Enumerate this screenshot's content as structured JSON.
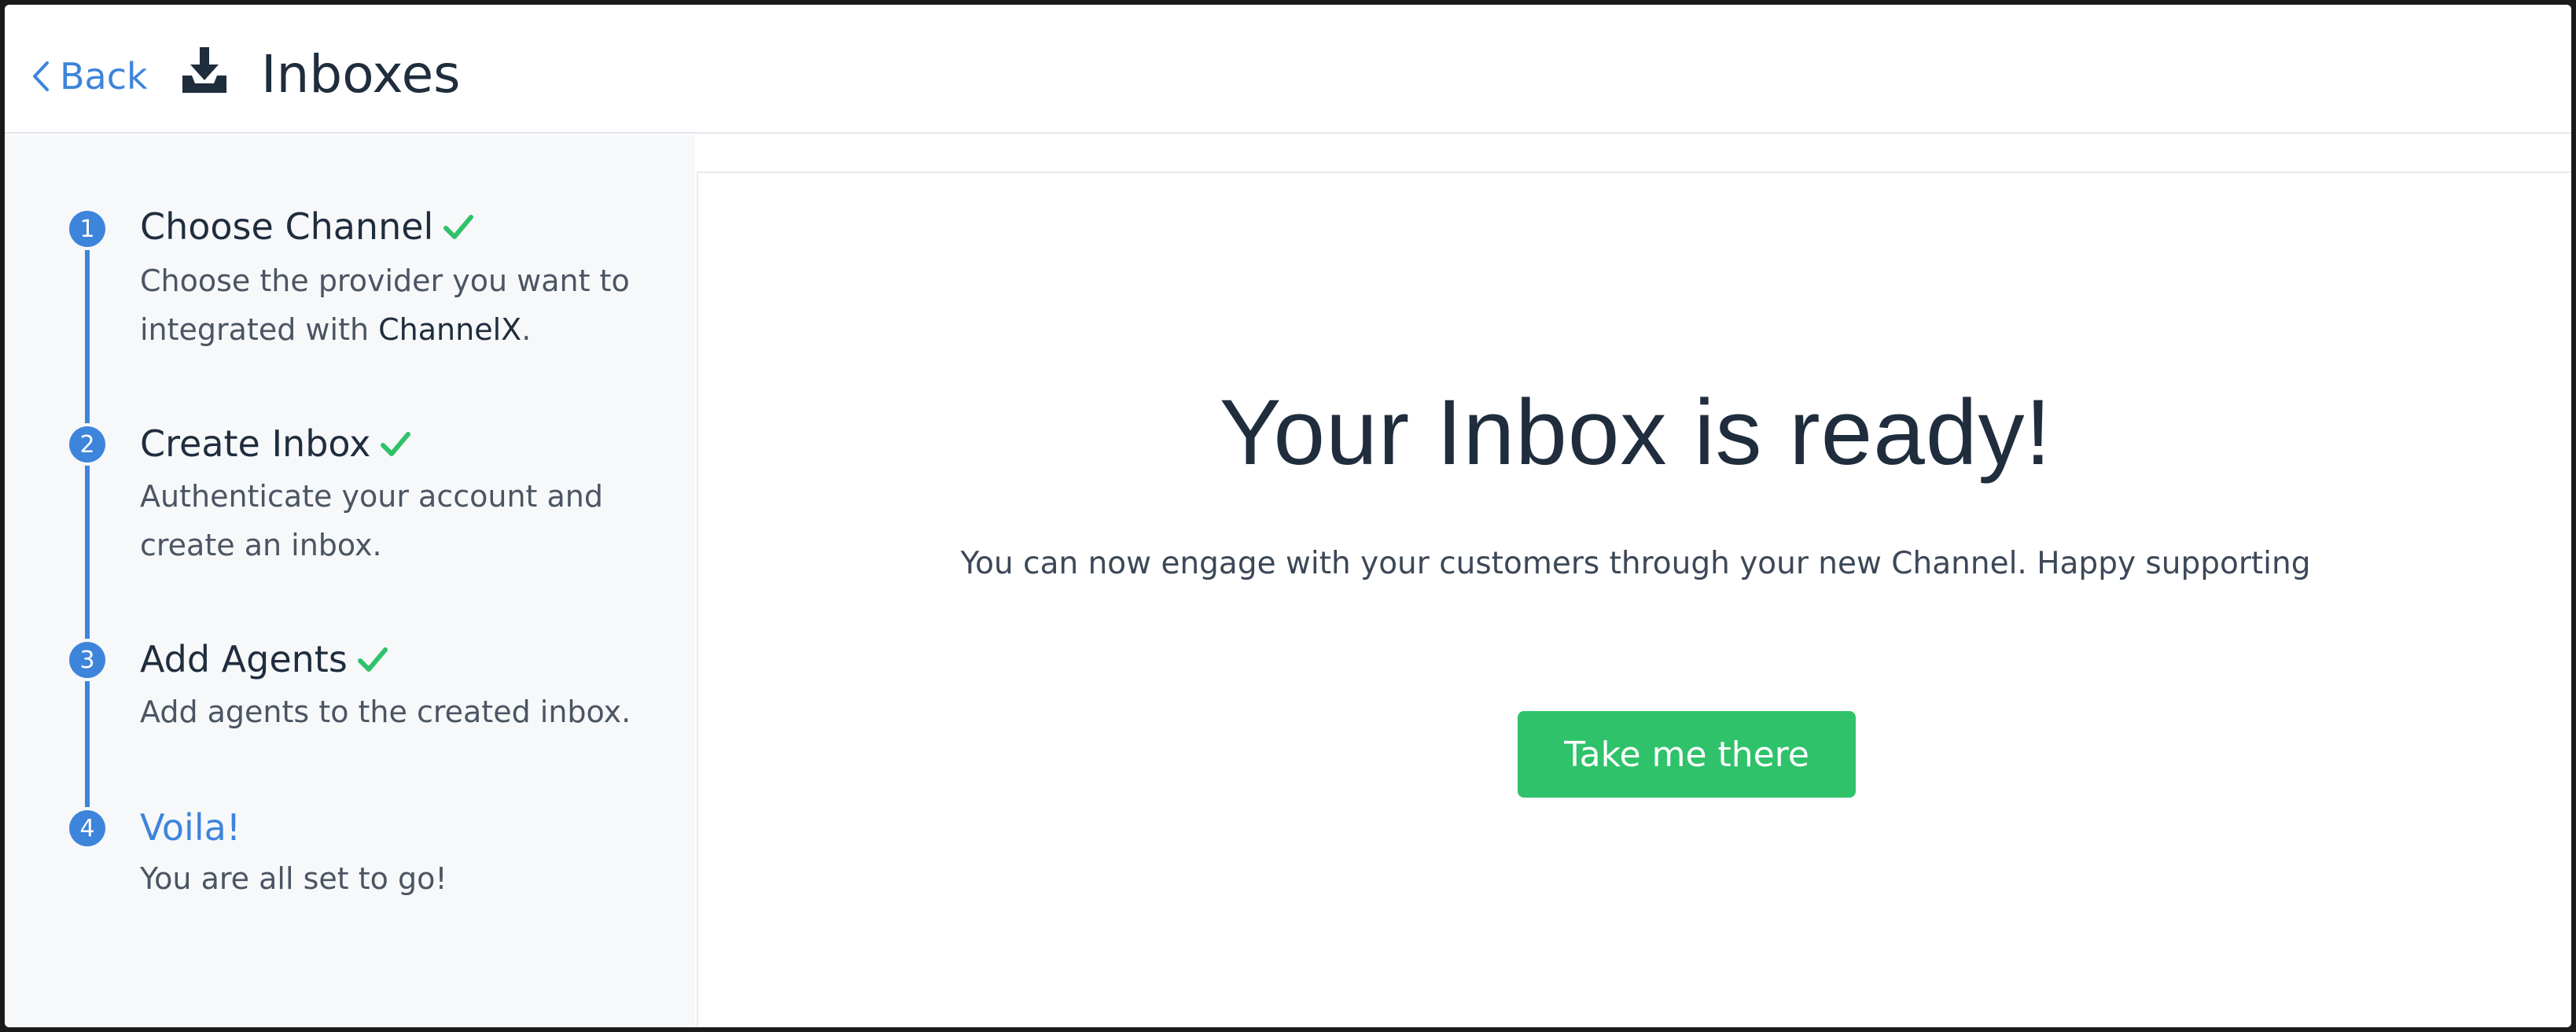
{
  "header": {
    "back_label": "Back",
    "back_icon": "chevron-left-icon",
    "title_icon": "inbox-download-icon",
    "title": "Inboxes"
  },
  "colors": {
    "accent": "#3d84db",
    "success": "#2fc26a",
    "sidebar_bg": "#f7f8fa",
    "text_dark": "#1f2d3d"
  },
  "steps": [
    {
      "number": "1",
      "title": "Choose Channel",
      "completed": true,
      "desc_before": "Choose the provider you want to integrated with ",
      "desc_brand": "ChannelX",
      "desc_after": "."
    },
    {
      "number": "2",
      "title": "Create Inbox",
      "completed": true,
      "description": "Authenticate your account and create an inbox."
    },
    {
      "number": "3",
      "title": "Add Agents",
      "completed": true,
      "description": "Add agents to the created inbox."
    },
    {
      "number": "4",
      "title": "Voila!",
      "completed": false,
      "active": true,
      "description": "You are all set to go!"
    }
  ],
  "main": {
    "title": "Your Inbox is ready!",
    "subtitle": "You can now engage with your customers through your new Channel. Happy supporting",
    "cta_label": "Take me there"
  }
}
